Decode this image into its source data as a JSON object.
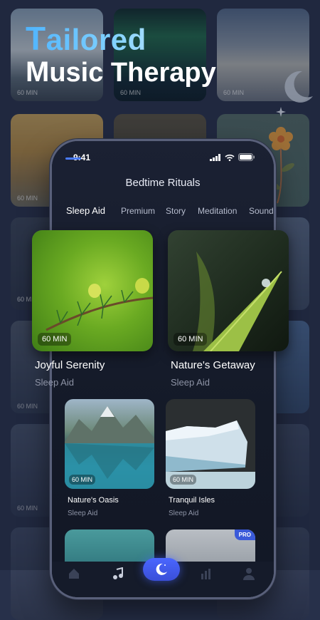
{
  "promo": {
    "headline_lead": "T",
    "headline_rest": "ailored",
    "subline_lead": "M",
    "subline_rest": "usic Therapy"
  },
  "background_tiles": [
    {
      "duration": "60 MIN"
    },
    {
      "duration": "60 MIN"
    },
    {
      "duration": "60 MIN"
    },
    {
      "duration": "60 MIN"
    },
    {
      "duration": "60 MIN"
    },
    {
      "duration": "60 MIN"
    }
  ],
  "phone": {
    "status": {
      "time": "9:41"
    },
    "title": "Bedtime Rituals",
    "tabs": [
      {
        "label": "Sleep Aid",
        "active": true
      },
      {
        "label": "Premium"
      },
      {
        "label": "Story"
      },
      {
        "label": "Meditation"
      },
      {
        "label": "Sounds"
      }
    ],
    "featured": [
      {
        "title": "Joyful Serenity",
        "category": "Sleep Aid",
        "duration": "60 MIN"
      },
      {
        "title": "Nature's Getaway",
        "category": "Sleep Aid",
        "duration": "60 MIN"
      }
    ],
    "cards": [
      {
        "title": "Nature's Oasis",
        "category": "Sleep Aid",
        "duration": "60 MIN"
      },
      {
        "title": "Tranquil Isles",
        "category": "Sleep Aid",
        "duration": "60 MIN"
      }
    ],
    "pro_badge": "PRO",
    "nav": [
      "home-icon",
      "music-note-icon",
      "moon-icon",
      "stats-icon",
      "profile-icon"
    ],
    "accent_color": "#4a7cff"
  }
}
